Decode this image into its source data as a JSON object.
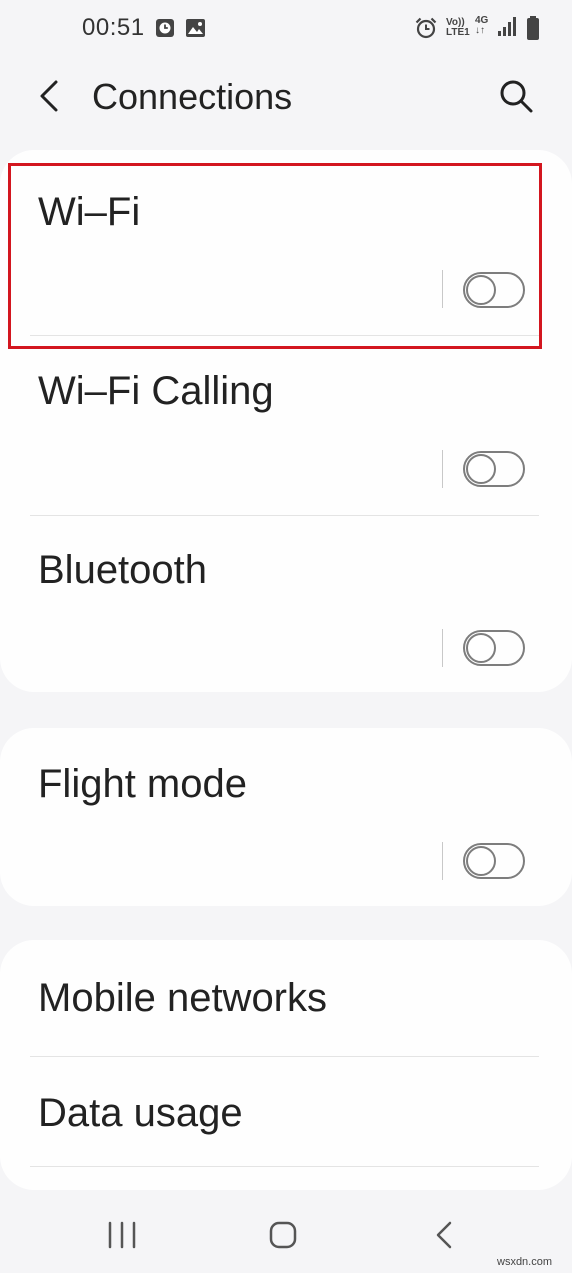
{
  "status_bar": {
    "time": "00:51",
    "icons": [
      "alarm-app-icon",
      "gallery-icon",
      "alarm-clock-icon",
      "volte-icon",
      "data-4g-icon",
      "signal-icon",
      "battery-icon"
    ],
    "volte_top": "Vo))",
    "volte_bottom": "LTE1",
    "network": "4G",
    "network_arrows": "↓↑"
  },
  "header": {
    "title": "Connections",
    "back_icon": "chevron-left-icon",
    "search_icon": "search-icon"
  },
  "settings": {
    "wifi": {
      "label": "Wi–Fi",
      "enabled": false
    },
    "wifi_calling": {
      "label": "Wi–Fi Calling",
      "enabled": false
    },
    "bluetooth": {
      "label": "Bluetooth",
      "enabled": false
    },
    "flight_mode": {
      "label": "Flight mode",
      "enabled": false
    },
    "mobile_networks": {
      "label": "Mobile networks"
    },
    "data_usage": {
      "label": "Data usage"
    }
  },
  "highlight_color": "#d3161f",
  "nav_bar": {
    "recents_icon": "recent-apps-icon",
    "home_icon": "home-icon",
    "back_icon": "back-arrow-icon"
  },
  "watermark": "wsxdn.com"
}
